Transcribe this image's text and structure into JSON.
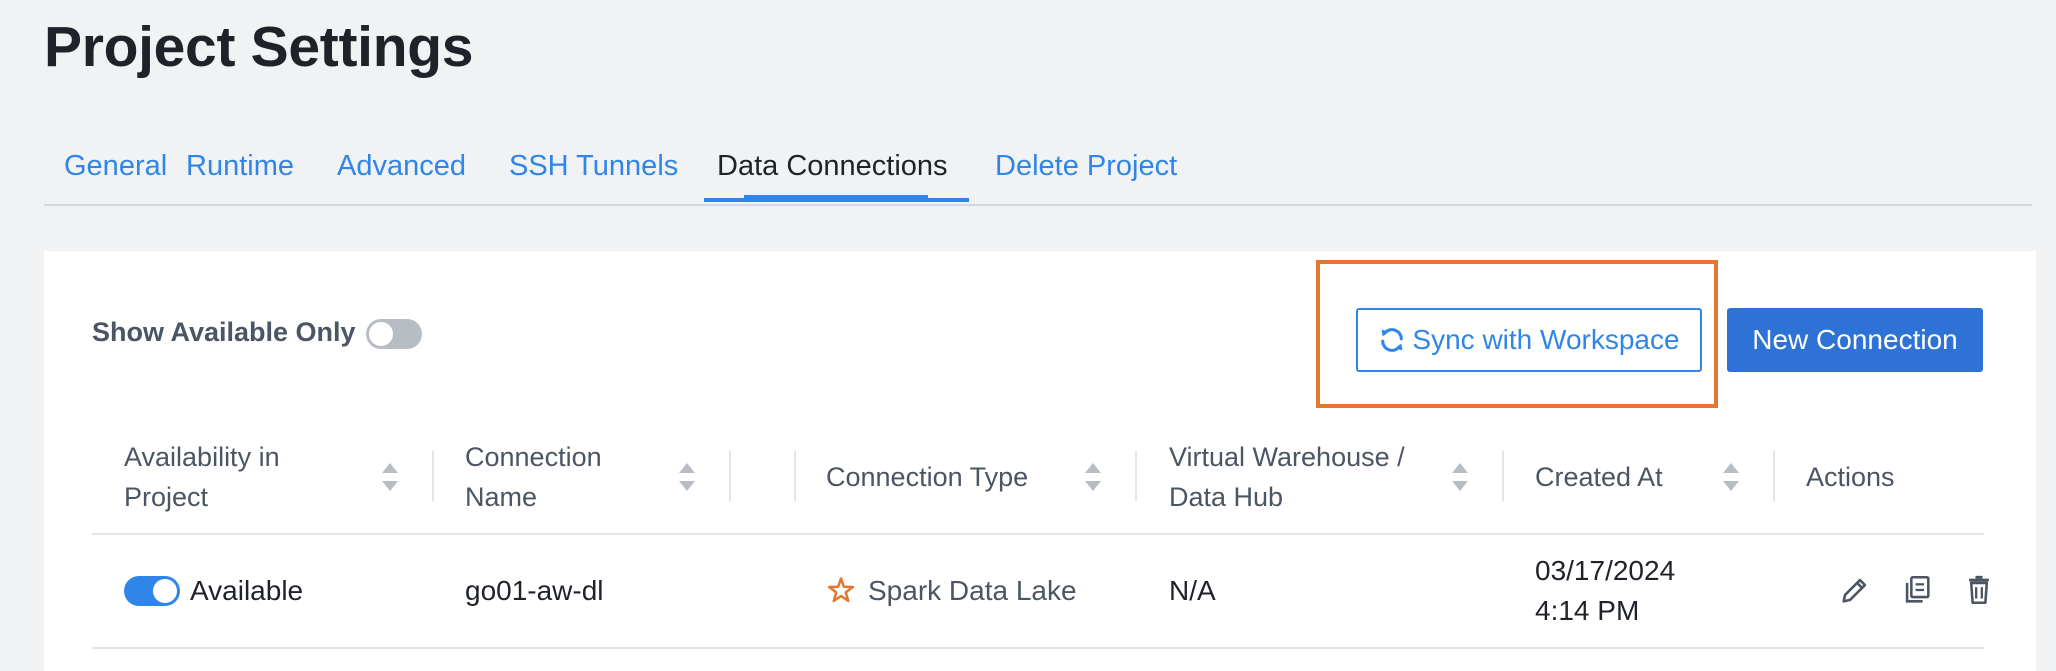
{
  "page": {
    "title": "Project Settings"
  },
  "tabs": [
    {
      "label": "General"
    },
    {
      "label": "Runtime"
    },
    {
      "label": "Advanced"
    },
    {
      "label": "SSH Tunnels"
    },
    {
      "label": "Data Connections"
    },
    {
      "label": "Delete Project"
    }
  ],
  "toolbar": {
    "filter_label": "Show Available Only",
    "sync_label": "Sync with Workspace",
    "new_label": "New Connection"
  },
  "table": {
    "headers": {
      "availability_line1": "Availability in",
      "availability_line2": "Project",
      "name_line1": "Connection",
      "name_line2": "Name",
      "type": "Connection Type",
      "warehouse_line1": "Virtual Warehouse /",
      "warehouse_line2": "Data Hub",
      "created": "Created At",
      "actions": "Actions"
    },
    "rows": [
      {
        "availability": "Available",
        "name": "go01-aw-dl",
        "type": "Spark Data Lake",
        "warehouse": "N/A",
        "created_date": "03/17/2024",
        "created_time": "4:14 PM"
      }
    ]
  },
  "colors": {
    "accent": "#2f86e8",
    "primary_button": "#2f72d6",
    "highlight": "#e2772d",
    "spark_icon": "#e2772d"
  }
}
